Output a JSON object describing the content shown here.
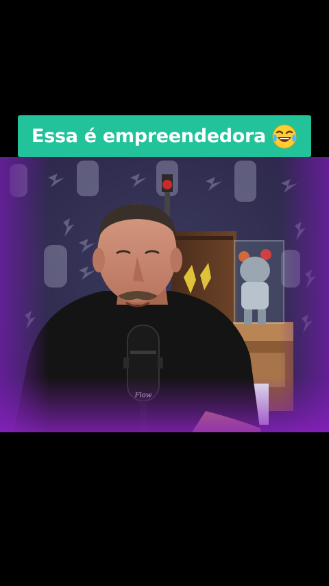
{
  "caption": {
    "text": "Essa é empreendedora",
    "emoji": "laughing-tears-emoji",
    "background_color": "#22c29a",
    "text_color": "#ffffff"
  },
  "video": {
    "scene": "podcast-host-at-microphone",
    "icons": [
      "lightning-pattern-icon",
      "microphone-icon",
      "bearbrick-figure",
      "shelf",
      "lamp"
    ]
  }
}
